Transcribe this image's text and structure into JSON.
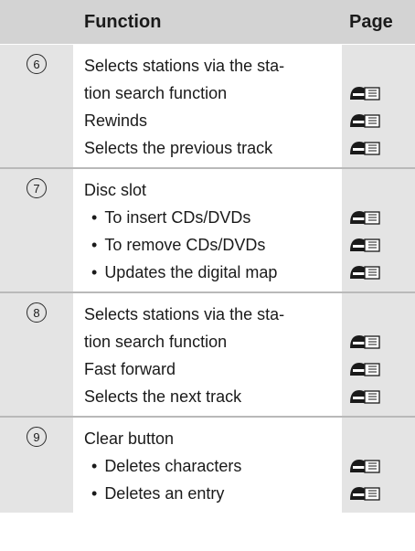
{
  "header": {
    "function": "Function",
    "page": "Page"
  },
  "rows": [
    {
      "num": "6",
      "lines": [
        {
          "text": "Selects stations via the sta-",
          "bullet": false,
          "ref": false
        },
        {
          "text": "tion search function",
          "bullet": false,
          "ref": true
        },
        {
          "text": "Rewinds",
          "bullet": false,
          "ref": true
        },
        {
          "text": "Selects the previous track",
          "bullet": false,
          "ref": true
        }
      ]
    },
    {
      "num": "7",
      "lines": [
        {
          "text": "Disc slot",
          "bullet": false,
          "ref": false
        },
        {
          "text": "To insert CDs/DVDs",
          "bullet": true,
          "ref": true
        },
        {
          "text": "To remove CDs/DVDs",
          "bullet": true,
          "ref": true
        },
        {
          "text": "Updates the digital map",
          "bullet": true,
          "ref": true
        }
      ]
    },
    {
      "num": "8",
      "lines": [
        {
          "text": "Selects stations via the sta-",
          "bullet": false,
          "ref": false
        },
        {
          "text": "tion search function",
          "bullet": false,
          "ref": true
        },
        {
          "text": "Fast forward",
          "bullet": false,
          "ref": true
        },
        {
          "text": "Selects the next track",
          "bullet": false,
          "ref": true
        }
      ]
    },
    {
      "num": "9",
      "lines": [
        {
          "text": "Clear button",
          "bullet": false,
          "ref": false
        },
        {
          "text": "Deletes characters",
          "bullet": true,
          "ref": true
        },
        {
          "text": "Deletes an entry",
          "bullet": true,
          "ref": true
        }
      ]
    }
  ]
}
